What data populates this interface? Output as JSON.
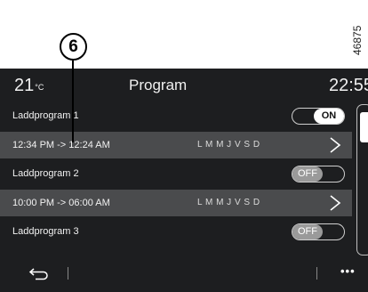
{
  "annotation": {
    "callout_number": "6",
    "reference_code": "46875"
  },
  "statusbar": {
    "temperature": "21",
    "temperature_unit": "°C",
    "title": "Program",
    "clock": "22:55"
  },
  "programs": [
    {
      "name": "Laddprogram 1",
      "toggle": "ON",
      "time_range": "12:34 PM -> 12:24 AM",
      "days": "L M M J V S D"
    },
    {
      "name": "Laddprogram 2",
      "toggle": "OFF",
      "time_range": "10:00 PM -> 06:00 AM",
      "days": "L M M J V S D"
    },
    {
      "name": "Laddprogram 3",
      "toggle": "OFF"
    }
  ],
  "bottombar": {
    "back_icon": "back-arrow-icon",
    "more_label": "•••"
  },
  "colors": {
    "screen_bg": "#1d1e20",
    "time_row_bg": "#4a4b4d",
    "toggle_on_knob": "#ffffff",
    "toggle_off_knob": "#9a9a9a"
  }
}
